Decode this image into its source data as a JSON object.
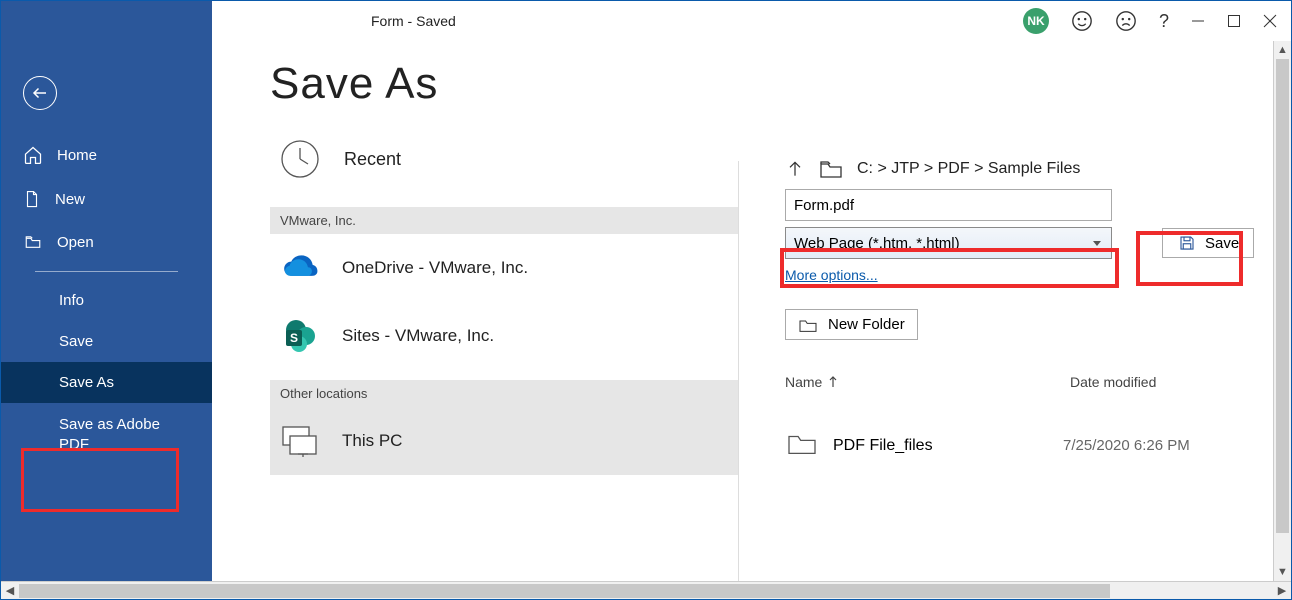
{
  "titlebar": {
    "title": "Form  -  Saved",
    "avatar_initials": "NK"
  },
  "sidebar": {
    "home": "Home",
    "new": "New",
    "open": "Open",
    "info": "Info",
    "save": "Save",
    "save_as": "Save As",
    "save_adobe": "Save as Adobe PDF"
  },
  "main": {
    "heading": "Save As",
    "recent": "Recent",
    "section_vmware": "VMware, Inc.",
    "onedrive": "OneDrive - VMware, Inc.",
    "sites": "Sites - VMware, Inc.",
    "section_other": "Other locations",
    "this_pc": "This PC"
  },
  "right": {
    "path": "C:  >  JTP  >  PDF  >  Sample Files",
    "filename": "Form.pdf",
    "filetype": "Web Page (*.htm, *.html)",
    "save_label": "Save",
    "more_options": "More options...",
    "new_folder": "New Folder",
    "list_head_name": "Name",
    "list_head_date": "Date modified",
    "row1_name": "PDF File_files",
    "row1_date": "7/25/2020 6:26 PM"
  }
}
